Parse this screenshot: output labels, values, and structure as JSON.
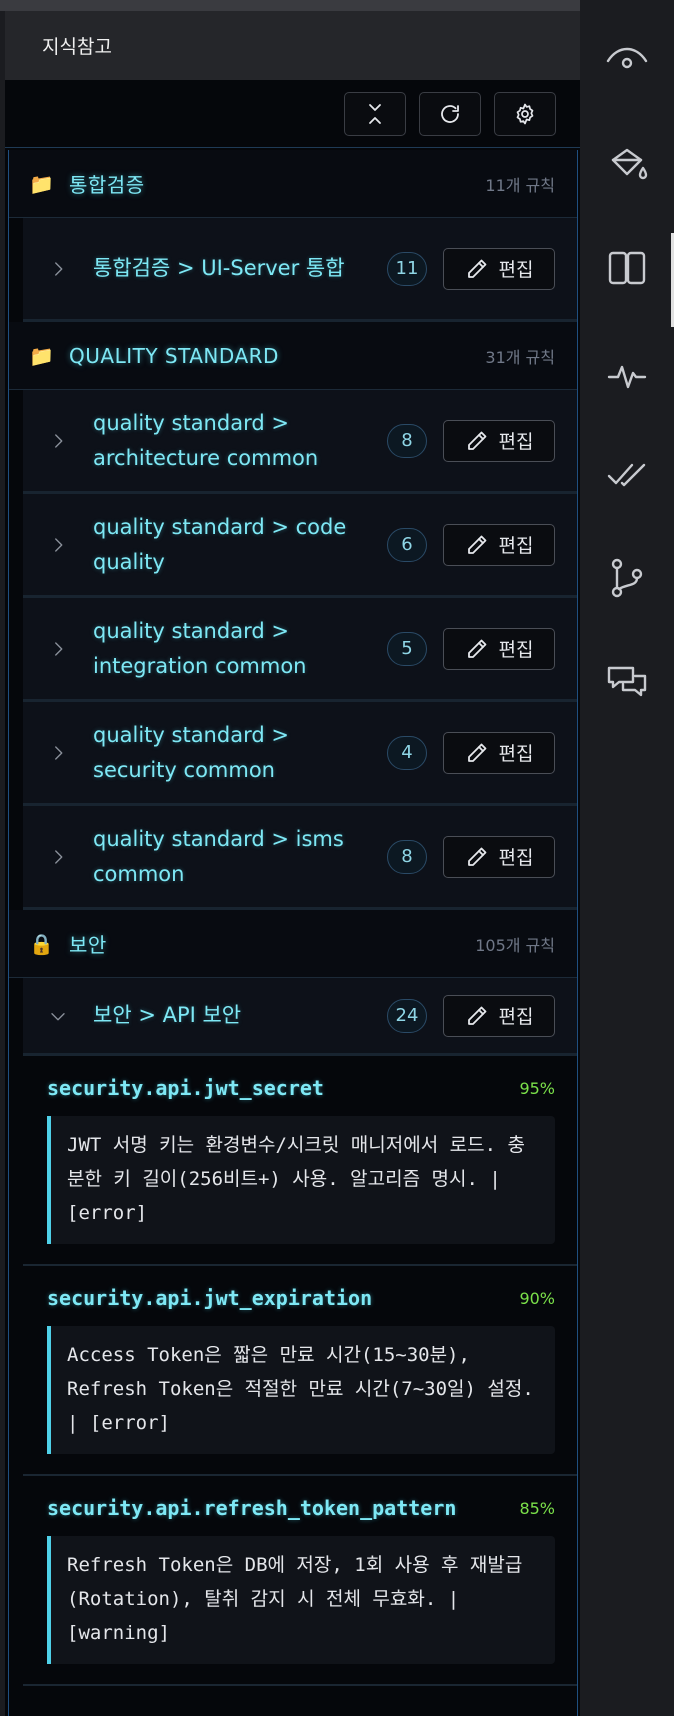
{
  "panel": {
    "title": "지식참고"
  },
  "toolbar": [
    {
      "name": "collapse-all-button",
      "icon": "collapse-all-icon"
    },
    {
      "name": "refresh-button",
      "icon": "refresh-icon"
    },
    {
      "name": "settings-button",
      "icon": "gear-icon"
    }
  ],
  "categories": [
    {
      "icon": "📁",
      "name": "통합검증",
      "count": "11개 규칙",
      "subs": [
        {
          "name": "통합검증 > UI-Server 통합",
          "count": "11",
          "edit": "편집",
          "expanded": false
        }
      ]
    },
    {
      "icon": "📁",
      "name": "QUALITY STANDARD",
      "count": "31개 규칙",
      "subs": [
        {
          "name": "quality standard > architecture common",
          "count": "8",
          "edit": "편집",
          "expanded": false
        },
        {
          "name": "quality standard > code quality",
          "count": "6",
          "edit": "편집",
          "expanded": false
        },
        {
          "name": "quality standard > integration common",
          "count": "5",
          "edit": "편집",
          "expanded": false
        },
        {
          "name": "quality standard > security common",
          "count": "4",
          "edit": "편집",
          "expanded": false
        },
        {
          "name": "quality standard > isms common",
          "count": "8",
          "edit": "편집",
          "expanded": false
        }
      ]
    },
    {
      "icon": "🔒",
      "name": "보안",
      "count": "105개 규칙",
      "subs": [
        {
          "name": "보안 > API 보안",
          "count": "24",
          "edit": "편집",
          "expanded": true,
          "rules": [
            {
              "id": "security.api.jwt_secret",
              "confidence": "95%",
              "description": "JWT 서명 키는 환경변수/시크릿 매니저에서 로드. 충분한 키 길이(256비트+) 사용. 알고리즘 명시. | [error]"
            },
            {
              "id": "security.api.jwt_expiration",
              "confidence": "90%",
              "description": "Access Token은 짧은 만료 시간(15~30분), Refresh Token은 적절한 만료 시간(7~30일) 설정. | [error]"
            },
            {
              "id": "security.api.refresh_token_pattern",
              "confidence": "85%",
              "description": "Refresh Token은 DB에 저장, 1회 사용 후 재발급(Rotation), 탈취 감지 시 전체 무효화. | [warning]"
            }
          ]
        }
      ]
    }
  ],
  "activity_bar": [
    {
      "icon": "eye-icon"
    },
    {
      "icon": "paint-bucket-icon"
    },
    {
      "icon": "book-icon",
      "active": true
    },
    {
      "icon": "pulse-icon"
    },
    {
      "icon": "double-check-icon"
    },
    {
      "icon": "git-branch-icon"
    },
    {
      "icon": "chat-bubbles-icon"
    }
  ]
}
